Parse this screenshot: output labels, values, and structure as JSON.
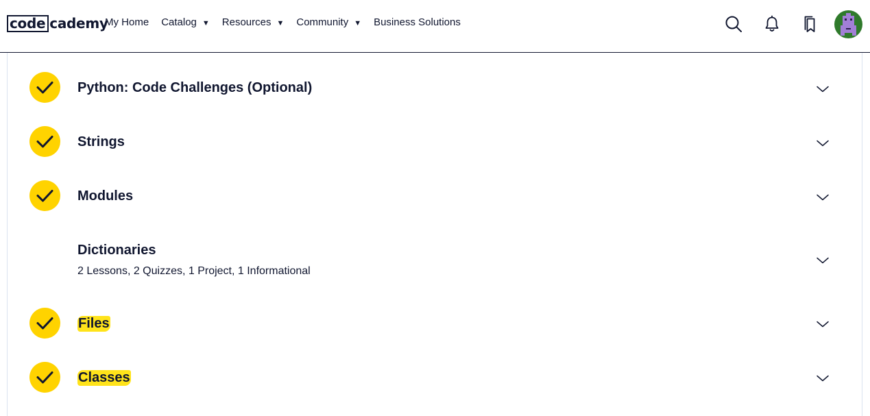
{
  "header": {
    "logo": {
      "boxed": "code",
      "rest": "cademy"
    },
    "nav": [
      {
        "label": "My Home",
        "has_caret": false
      },
      {
        "label": "Catalog",
        "has_caret": true
      },
      {
        "label": "Resources",
        "has_caret": true
      },
      {
        "label": "Community",
        "has_caret": true
      },
      {
        "label": "Business Solutions",
        "has_caret": false
      }
    ],
    "caret": "▼",
    "icons": [
      "search-icon",
      "bell-icon",
      "bookmark-icon"
    ],
    "avatar_colors": {
      "bg": "#2f7a2b",
      "figure": "#a27fd6"
    }
  },
  "modules": [
    {
      "title": "Python: Code Challenges (Optional)",
      "completed": true,
      "highlighted": false
    },
    {
      "title": "Strings",
      "completed": true,
      "highlighted": false
    },
    {
      "title": "Modules",
      "completed": true,
      "highlighted": false
    },
    {
      "title": "Dictionaries",
      "subtitle": "2 Lessons, 2 Quizzes, 1 Project, 1 Informational",
      "completed": false,
      "highlighted": false
    },
    {
      "title": "Files",
      "completed": true,
      "highlighted": true
    },
    {
      "title": "Classes",
      "completed": true,
      "highlighted": true
    }
  ],
  "colors": {
    "check_bg": "#ffd300",
    "highlight": "#ffe31a",
    "text": "#10162f"
  }
}
